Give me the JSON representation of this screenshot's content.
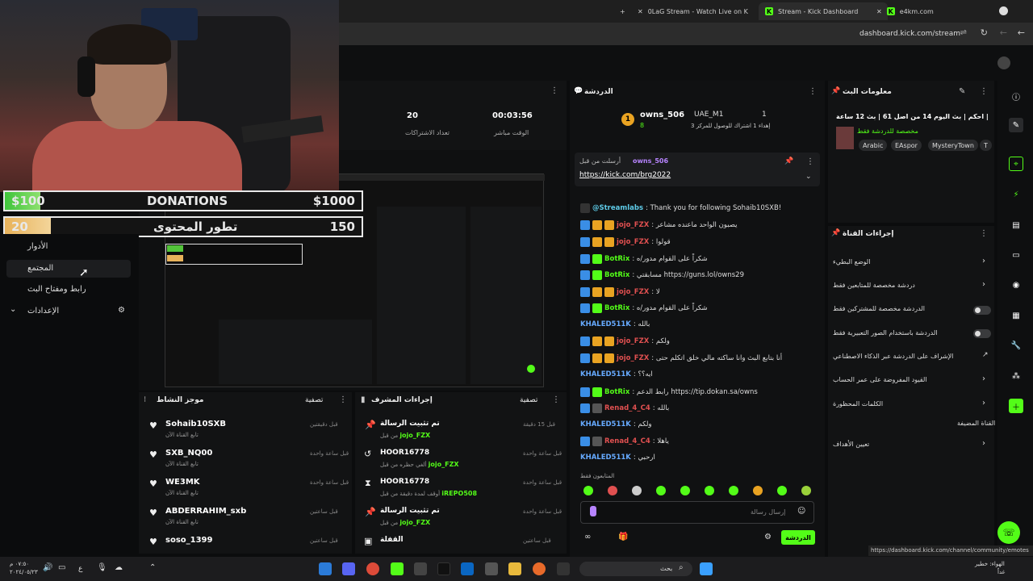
{
  "browser": {
    "tabs": [
      {
        "label": "0LaG Stream - Watch Live on K"
      },
      {
        "label": "Stream - Kick Dashboard"
      },
      {
        "label": "e4km.com"
      }
    ],
    "new_tab": "+",
    "close": "✕",
    "url": "dashboard.kick.com/stream",
    "status_url": "https://dashboard.kick.com/channel/community/emotes"
  },
  "overlay": {
    "donations": {
      "left": "$100",
      "title": "DONATIONS",
      "right": "$1000",
      "progress": 0.1
    },
    "content_goal": {
      "left": "20",
      "title": "تطور المحتوى",
      "right": "150",
      "progress": 0.13
    }
  },
  "leftnav": {
    "roles": "الأدوار",
    "community": "المجتمع",
    "stream_key": "رابط ومفتاح البث",
    "settings": "الإعدادات"
  },
  "stats": {
    "subs_value": "20",
    "subs_label": "تعداد الاشتراكات",
    "live_value": "00:03:56",
    "live_label": "الوقت مباشر"
  },
  "activity": {
    "title": "موجز النشاط",
    "filter": "تصفية",
    "items": [
      {
        "name": "Sohaib10SXB",
        "sub": "تابع القناة الآن",
        "time": "قبل دقيقتين"
      },
      {
        "name": "SXB_NQ00",
        "sub": "تابع القناة الآن",
        "time": "قبل ساعة واحدة"
      },
      {
        "name": "WE3MK",
        "sub": "تابع القناة الآن",
        "time": "قبل ساعة واحدة"
      },
      {
        "name": "ABDERRAHIM_sxb",
        "sub": "تابع القناة الآن",
        "time": "قبل ساعتين"
      },
      {
        "name": "soso_1399",
        "sub": "",
        "time": "قبل ساعتين"
      }
    ]
  },
  "modactions": {
    "title": "إجراءات المشرف",
    "filter": "تصفية",
    "items": [
      {
        "name": "تم تثبيت الرسالة",
        "sub": "من قبل",
        "user": "jojo_FZX",
        "time": "قبل 15 دقيقة"
      },
      {
        "name": "HOOR16778",
        "sub": "ألغي حظره من قبل",
        "user": "jojo_FZX",
        "time": "قبل ساعة واحدة"
      },
      {
        "name": "HOOR16778",
        "sub": "أوقف لمدة دقيقة من قبل",
        "user": "iREPO508",
        "time": "قبل ساعة واحدة"
      },
      {
        "name": "تم تثبيت الرسالة",
        "sub": "من قبل",
        "user": "jojo_FZX",
        "time": "قبل ساعة واحدة"
      },
      {
        "name": "القفلة",
        "sub": "",
        "user": "",
        "time": "قبل ساعتين"
      }
    ]
  },
  "chat": {
    "title": "الدردشة",
    "top_user1": "owns_506",
    "top_user1_count": "8",
    "top_user2": "UAE_M1",
    "top_user2_count": "1",
    "top_note": "إهداء 1 اشتراك للوصول للمركز 3",
    "pinned_by_label": "أرسلت من قبل",
    "pinned_by": "owns_506",
    "pinned_link": "https://kick.com/brg2022",
    "messages": [
      {
        "user": "@Streamlabs",
        "text": ": Thank you for following Sohaib10SXB!",
        "color": "uname-cyan"
      },
      {
        "user": "jojo_FZX",
        "text": ": يصبون الواحد ماعنده مشاعر",
        "color": "uname-red"
      },
      {
        "user": "jojo_FZX",
        "text": ": قولوا",
        "color": "uname-red"
      },
      {
        "user": "BotRix",
        "text": ": شكراً على القوام مدور/ه",
        "color": "uname-green"
      },
      {
        "user": "BotRix",
        "text": ": مسابقتي https://guns.lol/owns29",
        "color": "uname-green"
      },
      {
        "user": "jojo_FZX",
        "text": ": لا",
        "color": "uname-red"
      },
      {
        "user": "BotRix",
        "text": ": شكراً على القوام مدور/ه",
        "color": "uname-green"
      },
      {
        "user": "KHALED511K",
        "text": ": بالله",
        "color": "uname-blue"
      },
      {
        "user": "jojo_FZX",
        "text": ": ولكم",
        "color": "uname-red"
      },
      {
        "user": "jojo_FZX",
        "text": ": أنا بتابع البث وانا ساكته مالي خلق اتكلم حتى",
        "color": "uname-red"
      },
      {
        "user": "KHALED511K",
        "text": ": ايه؟؟",
        "color": "uname-blue"
      },
      {
        "user": "BotRix",
        "text": ": رابط الدعم https://tip.dokan.sa/owns",
        "color": "uname-green"
      },
      {
        "user": "Renad_4_C4",
        "text": ": بالله",
        "color": "uname-red"
      },
      {
        "user": "KHALED511K",
        "text": ": ولكم",
        "color": "uname-blue"
      },
      {
        "user": "Renad_4_C4",
        "text": ": ياهلا",
        "color": "uname-red"
      },
      {
        "user": "KHALED511K",
        "text": ": ارحبي",
        "color": "uname-blue"
      }
    ],
    "followers_only": "المتابعون فقط",
    "input_placeholder": "إرسال رسالة",
    "send": "الدردشة"
  },
  "streaminfo": {
    "title": "معلومات البث",
    "stream_title": "احكم | بث اليوم 14 من اصل 61 | بث 12 ساعة | !MT",
    "category": "مخصصة للدردشة فقط",
    "tags": [
      "Arabic",
      "EAspor",
      "MysteryTown",
      "T"
    ]
  },
  "channel_actions": {
    "title": "إجراءات القناة",
    "items": [
      {
        "label": "الوضع البطيء",
        "control": "chevron"
      },
      {
        "label": "دردشة مخصصة للمتابعين فقط",
        "control": "chevron"
      },
      {
        "label": "الدردشة مخصصة للمشتركين فقط",
        "control": "toggle"
      },
      {
        "label": "الدردشة باستخدام الصور التعبيرية فقط",
        "control": "toggle"
      },
      {
        "label": "الإشراف على الدردشة عبر الذكاء الاصطناعي",
        "control": "external"
      },
      {
        "label": "القيود المفروضة على عمر الحساب",
        "control": "chevron"
      },
      {
        "label": "الكلمات المحظورة",
        "control": "chevron"
      },
      {
        "label": "القناة المضيفة",
        "control": "none"
      },
      {
        "label": "تعيين الأهداف",
        "control": "chevron"
      }
    ]
  },
  "taskbar": {
    "search": "بحث",
    "weather": "الهواء: خطير",
    "weather_sub": "غداً",
    "time": "٠٧:٥٠ م",
    "date": "٢٠٢٤/٠٥/٢٣",
    "lang": "ع"
  }
}
